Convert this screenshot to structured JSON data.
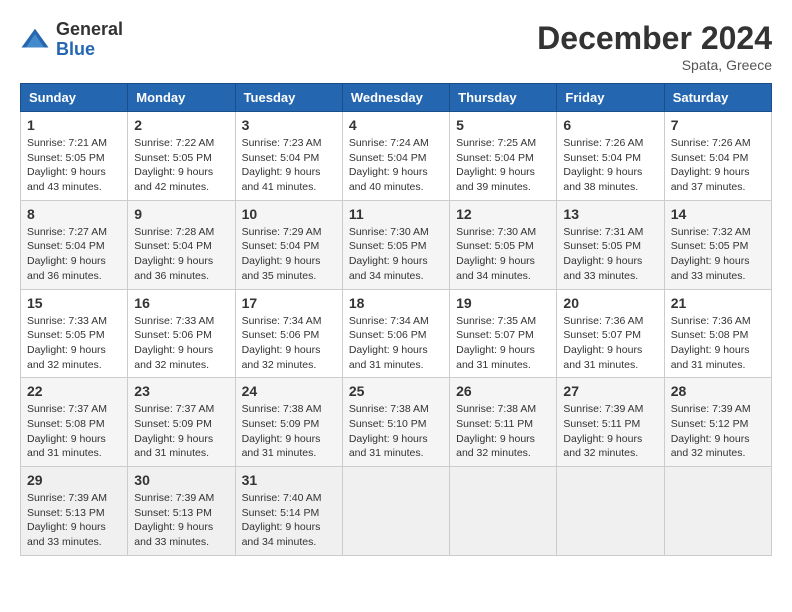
{
  "header": {
    "logo_general": "General",
    "logo_blue": "Blue",
    "month_year": "December 2024",
    "location": "Spata, Greece"
  },
  "weekdays": [
    "Sunday",
    "Monday",
    "Tuesday",
    "Wednesday",
    "Thursday",
    "Friday",
    "Saturday"
  ],
  "weeks": [
    [
      {
        "day": "1",
        "sunrise": "7:21 AM",
        "sunset": "5:05 PM",
        "daylight": "9 hours and 43 minutes."
      },
      {
        "day": "2",
        "sunrise": "7:22 AM",
        "sunset": "5:05 PM",
        "daylight": "9 hours and 42 minutes."
      },
      {
        "day": "3",
        "sunrise": "7:23 AM",
        "sunset": "5:04 PM",
        "daylight": "9 hours and 41 minutes."
      },
      {
        "day": "4",
        "sunrise": "7:24 AM",
        "sunset": "5:04 PM",
        "daylight": "9 hours and 40 minutes."
      },
      {
        "day": "5",
        "sunrise": "7:25 AM",
        "sunset": "5:04 PM",
        "daylight": "9 hours and 39 minutes."
      },
      {
        "day": "6",
        "sunrise": "7:26 AM",
        "sunset": "5:04 PM",
        "daylight": "9 hours and 38 minutes."
      },
      {
        "day": "7",
        "sunrise": "7:26 AM",
        "sunset": "5:04 PM",
        "daylight": "9 hours and 37 minutes."
      }
    ],
    [
      {
        "day": "8",
        "sunrise": "7:27 AM",
        "sunset": "5:04 PM",
        "daylight": "9 hours and 36 minutes."
      },
      {
        "day": "9",
        "sunrise": "7:28 AM",
        "sunset": "5:04 PM",
        "daylight": "9 hours and 36 minutes."
      },
      {
        "day": "10",
        "sunrise": "7:29 AM",
        "sunset": "5:04 PM",
        "daylight": "9 hours and 35 minutes."
      },
      {
        "day": "11",
        "sunrise": "7:30 AM",
        "sunset": "5:05 PM",
        "daylight": "9 hours and 34 minutes."
      },
      {
        "day": "12",
        "sunrise": "7:30 AM",
        "sunset": "5:05 PM",
        "daylight": "9 hours and 34 minutes."
      },
      {
        "day": "13",
        "sunrise": "7:31 AM",
        "sunset": "5:05 PM",
        "daylight": "9 hours and 33 minutes."
      },
      {
        "day": "14",
        "sunrise": "7:32 AM",
        "sunset": "5:05 PM",
        "daylight": "9 hours and 33 minutes."
      }
    ],
    [
      {
        "day": "15",
        "sunrise": "7:33 AM",
        "sunset": "5:05 PM",
        "daylight": "9 hours and 32 minutes."
      },
      {
        "day": "16",
        "sunrise": "7:33 AM",
        "sunset": "5:06 PM",
        "daylight": "9 hours and 32 minutes."
      },
      {
        "day": "17",
        "sunrise": "7:34 AM",
        "sunset": "5:06 PM",
        "daylight": "9 hours and 32 minutes."
      },
      {
        "day": "18",
        "sunrise": "7:34 AM",
        "sunset": "5:06 PM",
        "daylight": "9 hours and 31 minutes."
      },
      {
        "day": "19",
        "sunrise": "7:35 AM",
        "sunset": "5:07 PM",
        "daylight": "9 hours and 31 minutes."
      },
      {
        "day": "20",
        "sunrise": "7:36 AM",
        "sunset": "5:07 PM",
        "daylight": "9 hours and 31 minutes."
      },
      {
        "day": "21",
        "sunrise": "7:36 AM",
        "sunset": "5:08 PM",
        "daylight": "9 hours and 31 minutes."
      }
    ],
    [
      {
        "day": "22",
        "sunrise": "7:37 AM",
        "sunset": "5:08 PM",
        "daylight": "9 hours and 31 minutes."
      },
      {
        "day": "23",
        "sunrise": "7:37 AM",
        "sunset": "5:09 PM",
        "daylight": "9 hours and 31 minutes."
      },
      {
        "day": "24",
        "sunrise": "7:38 AM",
        "sunset": "5:09 PM",
        "daylight": "9 hours and 31 minutes."
      },
      {
        "day": "25",
        "sunrise": "7:38 AM",
        "sunset": "5:10 PM",
        "daylight": "9 hours and 31 minutes."
      },
      {
        "day": "26",
        "sunrise": "7:38 AM",
        "sunset": "5:11 PM",
        "daylight": "9 hours and 32 minutes."
      },
      {
        "day": "27",
        "sunrise": "7:39 AM",
        "sunset": "5:11 PM",
        "daylight": "9 hours and 32 minutes."
      },
      {
        "day": "28",
        "sunrise": "7:39 AM",
        "sunset": "5:12 PM",
        "daylight": "9 hours and 32 minutes."
      }
    ],
    [
      {
        "day": "29",
        "sunrise": "7:39 AM",
        "sunset": "5:13 PM",
        "daylight": "9 hours and 33 minutes."
      },
      {
        "day": "30",
        "sunrise": "7:39 AM",
        "sunset": "5:13 PM",
        "daylight": "9 hours and 33 minutes."
      },
      {
        "day": "31",
        "sunrise": "7:40 AM",
        "sunset": "5:14 PM",
        "daylight": "9 hours and 34 minutes."
      },
      null,
      null,
      null,
      null
    ]
  ],
  "labels": {
    "sunrise": "Sunrise:",
    "sunset": "Sunset:",
    "daylight": "Daylight:"
  }
}
